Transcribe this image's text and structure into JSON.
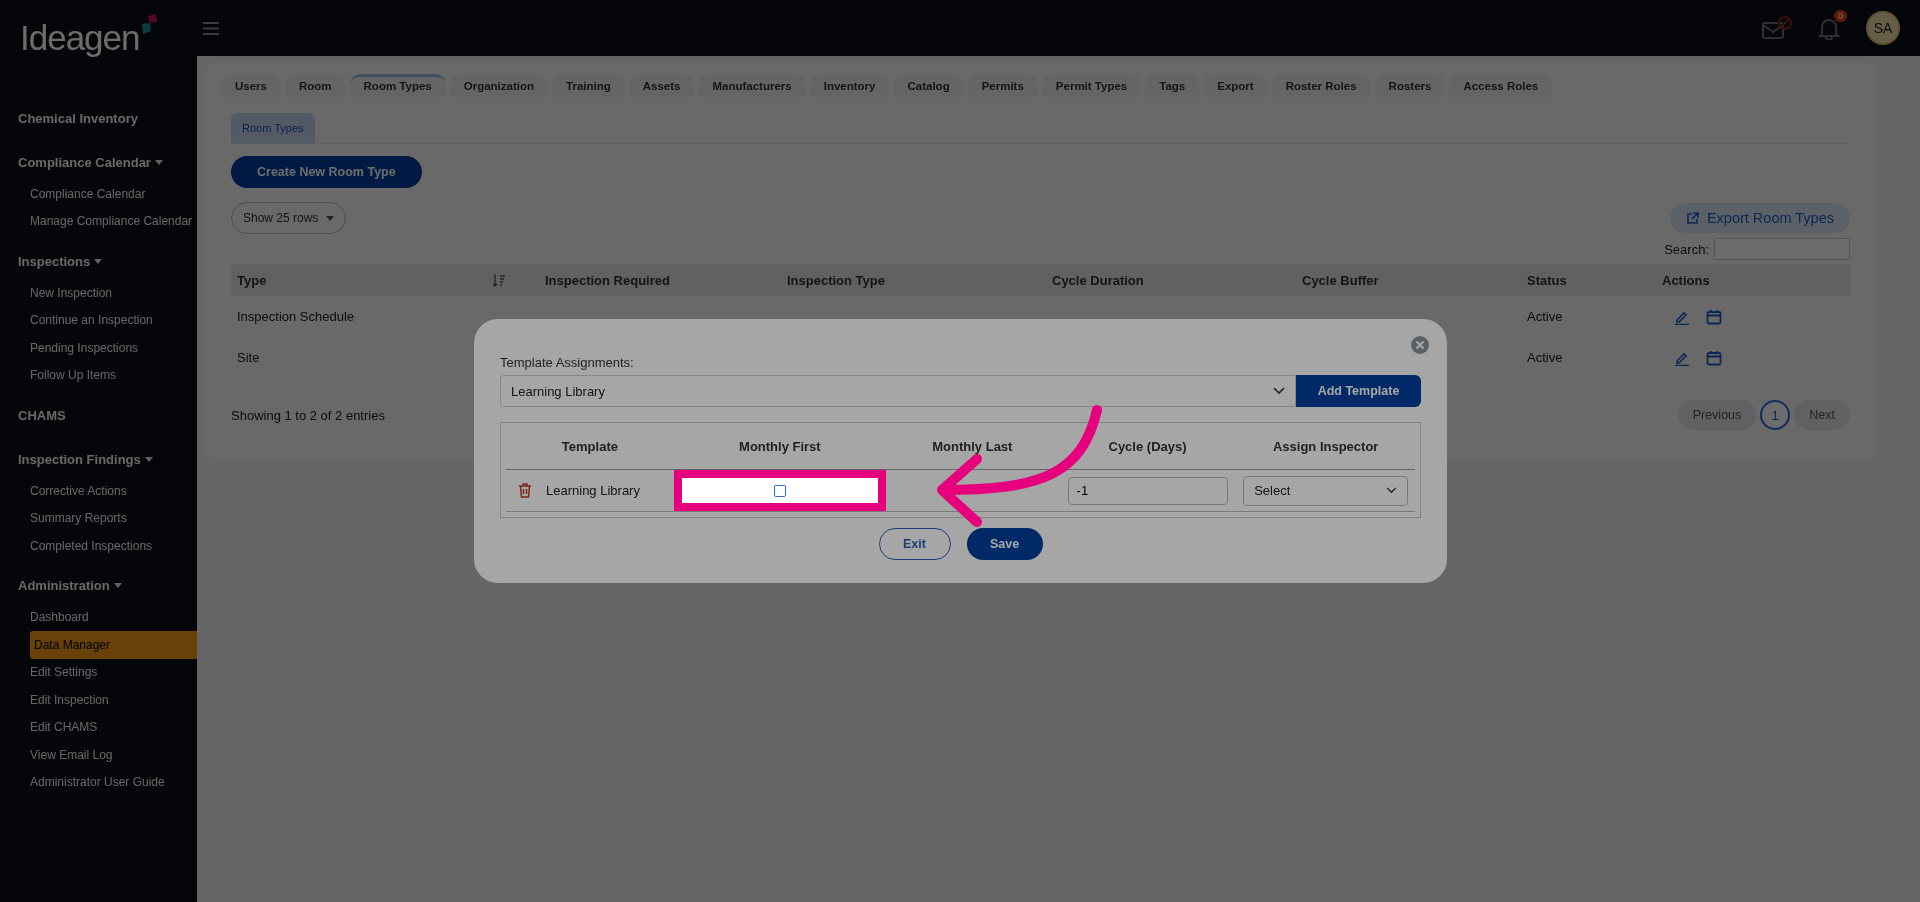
{
  "header": {
    "logo": "Ideagen",
    "notification_count": "0",
    "avatar": "SA"
  },
  "sidebar": {
    "sections": [
      {
        "label": "Chemical Inventory",
        "expandable": false
      },
      {
        "label": "Compliance Calendar",
        "expandable": true,
        "children": [
          {
            "label": "Compliance Calendar",
            "selected": false
          },
          {
            "label": "Manage Compliance Calendar",
            "selected": false
          }
        ]
      },
      {
        "label": "Inspections",
        "expandable": true,
        "children": [
          {
            "label": "New Inspection",
            "selected": false
          },
          {
            "label": "Continue an Inspection",
            "selected": false
          },
          {
            "label": "Pending Inspections",
            "selected": false
          },
          {
            "label": "Follow Up Items",
            "selected": false
          }
        ]
      },
      {
        "label": "CHAMS",
        "expandable": false
      },
      {
        "label": "Inspection Findings",
        "expandable": true,
        "children": [
          {
            "label": "Corrective Actions",
            "selected": false
          },
          {
            "label": "Summary Reports",
            "selected": false
          },
          {
            "label": "Completed Inspections",
            "selected": false
          }
        ]
      },
      {
        "label": "Administration",
        "expandable": true,
        "children": [
          {
            "label": "Dashboard",
            "selected": false
          },
          {
            "label": "Data Manager",
            "selected": true
          },
          {
            "label": "Edit Settings",
            "selected": false
          },
          {
            "label": "Edit Inspection",
            "selected": false
          },
          {
            "label": "Edit CHAMS",
            "selected": false
          },
          {
            "label": "View Email Log",
            "selected": false
          },
          {
            "label": "Administrator User Guide",
            "selected": false
          }
        ]
      }
    ]
  },
  "tabs": [
    {
      "label": "Users",
      "selected": false
    },
    {
      "label": "Room",
      "selected": false
    },
    {
      "label": "Room Types",
      "selected": true
    },
    {
      "label": "Organization",
      "selected": false
    },
    {
      "label": "Training",
      "selected": false
    },
    {
      "label": "Assets",
      "selected": false
    },
    {
      "label": "Manufacturers",
      "selected": false
    },
    {
      "label": "Inventory",
      "selected": false
    },
    {
      "label": "Catalog",
      "selected": false
    },
    {
      "label": "Permits",
      "selected": false
    },
    {
      "label": "Permit Types",
      "selected": false
    },
    {
      "label": "Tags",
      "selected": false
    },
    {
      "label": "Export",
      "selected": false
    },
    {
      "label": "Roster Roles",
      "selected": false
    },
    {
      "label": "Rosters",
      "selected": false
    },
    {
      "label": "Access Roles",
      "selected": false
    }
  ],
  "sub_tabs": [
    {
      "label": "Room Types",
      "selected": true
    }
  ],
  "create_button": "Create New Room Type",
  "rows_select": "Show 25 rows",
  "export_button": "Export Room Types",
  "search": {
    "label": "Search:"
  },
  "table": {
    "columns": [
      "Type",
      "Inspection Required",
      "Inspection Type",
      "Cycle Duration",
      "Cycle Buffer",
      "Status",
      "Actions"
    ],
    "rows": [
      {
        "type": "Inspection Schedule",
        "status": "Active"
      },
      {
        "type": "Site",
        "status": "Active"
      }
    ]
  },
  "info": "Showing 1 to 2 of 2 entries",
  "pagination": {
    "previous": "Previous",
    "pages": [
      {
        "label": "1",
        "selected": true
      }
    ],
    "next": "Next"
  },
  "modal": {
    "label": "Template Assignments:",
    "template_select": "Learning Library",
    "add_button": "Add Template",
    "columns": [
      "Template",
      "Monthly First",
      "Monthly Last",
      "Cycle (Days)",
      "Assign Inspector"
    ],
    "rows": [
      {
        "template": "Learning Library",
        "monthly_first_checked": false,
        "cycle_days": "-1",
        "inspector": "Select"
      }
    ],
    "exit": "Exit",
    "save": "Save"
  }
}
